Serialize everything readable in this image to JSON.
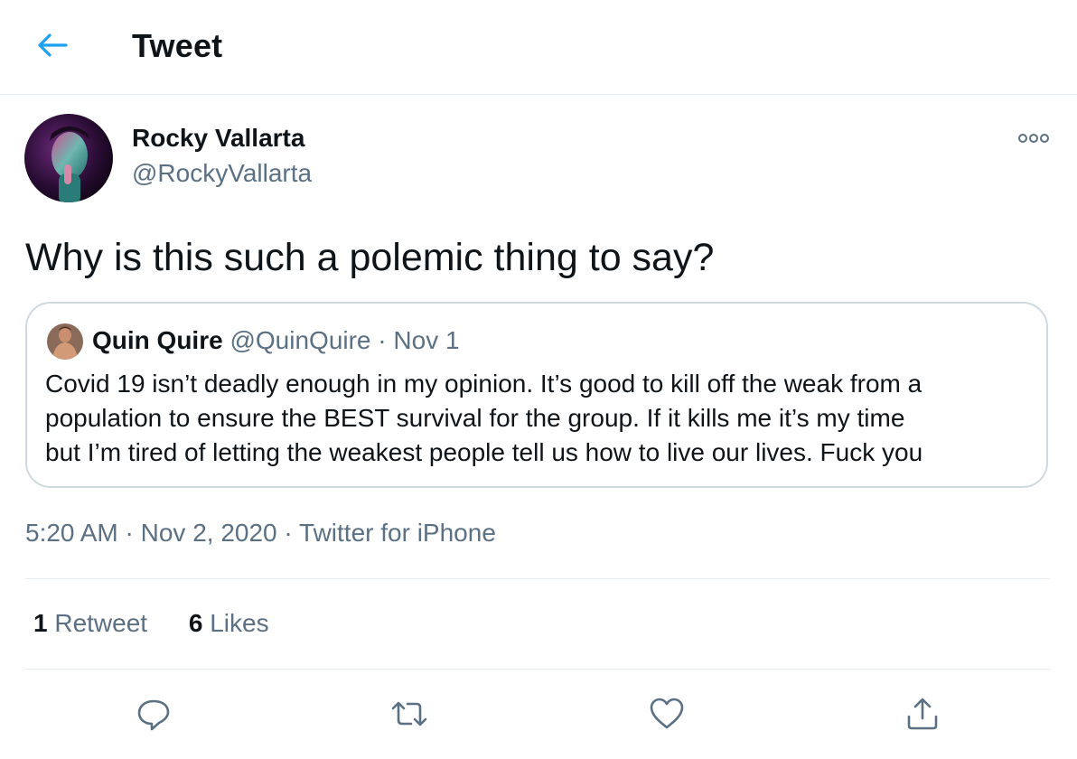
{
  "header": {
    "title": "Tweet",
    "back_icon": "arrow-left-icon"
  },
  "tweet": {
    "author_name": "Rocky Vallarta",
    "author_handle": "@RockyVallarta",
    "text": "Why is this such a polemic thing to say?",
    "more_icon": "more-icon",
    "timestamp": "5:20 AM",
    "separator": " · ",
    "date": "Nov 2, 2020",
    "source": "Twitter for iPhone"
  },
  "quoted_tweet": {
    "author_name": "Quin Quire",
    "author_handle": "@QuinQuire",
    "separator": " · ",
    "date": "Nov 1",
    "text_lines": [
      "Covid 19 isn’t deadly enough in my opinion. It’s good to kill off the weak from a",
      "population to ensure the BEST survival for the group. If it kills me it’s my time",
      "but I’m tired of letting the weakest people tell us how to live our lives. Fuck you"
    ]
  },
  "stats": {
    "retweets_count": "1",
    "retweets_label": "Retweet",
    "likes_count": "6",
    "likes_label": "Likes"
  },
  "actions": {
    "reply_icon": "reply-icon",
    "retweet_icon": "retweet-icon",
    "like_icon": "heart-icon",
    "share_icon": "share-icon"
  },
  "colors": {
    "accent": "#1da1f2",
    "secondary_text": "#5b7083",
    "border": "#cfd9de"
  }
}
